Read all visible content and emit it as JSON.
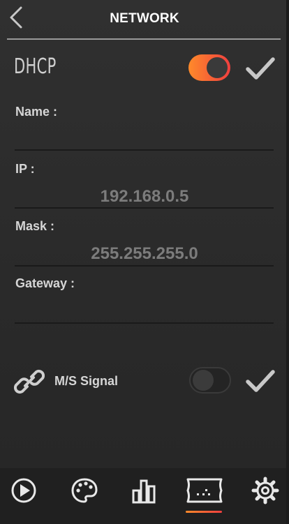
{
  "header": {
    "title": "NETWORK"
  },
  "dhcp": {
    "label": "DHCP",
    "enabled": true
  },
  "fields": {
    "name_label": "Name :",
    "name_value": "",
    "ip_label": "IP :",
    "ip_value": "192.168.0.5",
    "mask_label": "Mask :",
    "mask_value": "255.255.255.0",
    "gateway_label": "Gateway :",
    "gateway_value": ""
  },
  "ms_signal": {
    "label": "M/S Signal",
    "enabled": false
  },
  "bottom_nav": {
    "items": [
      "play-icon",
      "palette-icon",
      "bar-chart-icon",
      "screen-setup-icon",
      "gear-icon"
    ],
    "active_index": 3
  },
  "colors": {
    "accent_start": "#ff8a2a",
    "accent_end": "#ef3f3f",
    "background": "#2b2b2b"
  }
}
